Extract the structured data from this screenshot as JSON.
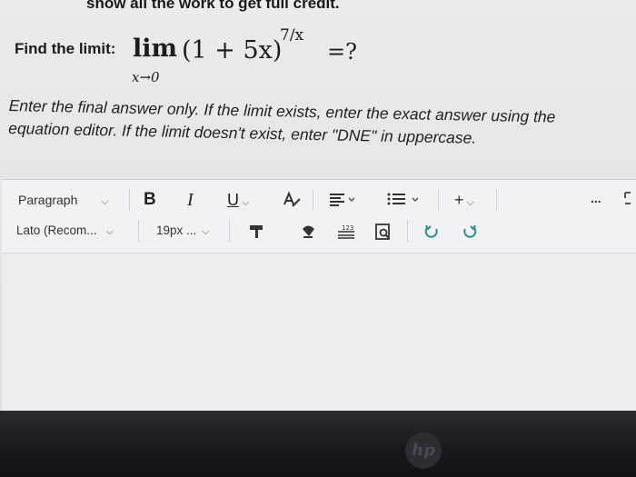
{
  "instruction_header": "show all the work to get full credit.",
  "question": {
    "label": "Find the limit:",
    "lim": "lim",
    "subscript": "x→0",
    "expression": "(1 + 5x)",
    "exponent": "7/x",
    "equals": "=?"
  },
  "instructions_text": "Enter the final answer only. If the limit exists, enter the exact answer using the equation editor. If the limit doesn't exist, enter \"DNE\" in uppercase.",
  "toolbar": {
    "paragraph_label": "Paragraph",
    "bold_label": "B",
    "italic_label": "I",
    "underline_label": "U",
    "more_label": "...",
    "insert_label": "+",
    "font_label": "Lato (Recom...",
    "size_label": "19px ...",
    "icons": [
      "format-painter-icon",
      "text-color-icon",
      "align-icon",
      "bullet-list-icon",
      "numbered-list-icon",
      "insert-icon",
      "paint-brush-icon",
      "highlight-icon",
      "equation-icon",
      "find-replace-icon",
      "undo-icon",
      "redo-icon",
      "fullscreen-icon"
    ]
  },
  "colors": {
    "screen_bg": "#e8e7e9",
    "editor_bg": "#f2f2f4",
    "bezel": "#17181c",
    "teal": "#2a8f8f"
  },
  "logo": "hp"
}
